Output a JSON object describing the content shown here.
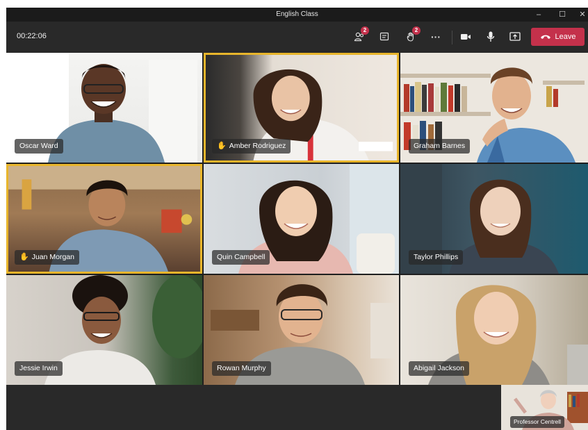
{
  "window": {
    "title": "English Class",
    "controls": {
      "minimize": "–",
      "maximize": "☐",
      "close": "✕"
    }
  },
  "meeting_bar": {
    "elapsed": "00:22:06",
    "participants_badge": "2",
    "raise_hand_badge": "2",
    "more_label": "···",
    "leave_label": "Leave",
    "leave_color": "#c4314b"
  },
  "participants": [
    {
      "name": "Oscar Ward",
      "hand_raised": false,
      "active": false
    },
    {
      "name": "Amber Rodriguez",
      "hand_raised": true,
      "active": true
    },
    {
      "name": "Graham Barnes",
      "hand_raised": false,
      "active": false
    },
    {
      "name": "Juan Morgan",
      "hand_raised": true,
      "active": true
    },
    {
      "name": "Quin Campbell",
      "hand_raised": false,
      "active": false
    },
    {
      "name": "Taylor Phillips",
      "hand_raised": false,
      "active": false
    },
    {
      "name": "Jessie Irwin",
      "hand_raised": false,
      "active": false
    },
    {
      "name": "Rowan Murphy",
      "hand_raised": false,
      "active": false
    },
    {
      "name": "Abigail Jackson",
      "hand_raised": false,
      "active": false
    }
  ],
  "hand_icon": "✋",
  "self_view": {
    "name": "Professor Centrell"
  },
  "colors": {
    "active_border": "#e8b52b",
    "background": "#1f1f1f",
    "toolbar": "#292929"
  }
}
